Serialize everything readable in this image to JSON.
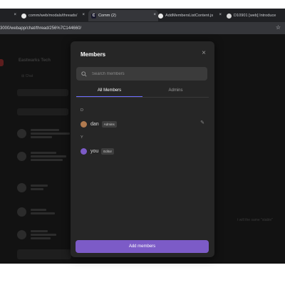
{
  "browser": {
    "tabs": [
      {
        "label": "",
        "close": "×"
      },
      {
        "label": "comm/web/modals/threads/",
        "close": "×",
        "icon": "github-icon"
      },
      {
        "label": "Comm (2)",
        "close": "×",
        "icon": "comm-icon",
        "icon_text": "C",
        "active": true
      },
      {
        "label": "AddMembersListContent.js",
        "close": "×",
        "icon": "github-icon"
      },
      {
        "label": "D10901 [web] Introduce",
        "close": "",
        "icon": "phabricator-icon"
      }
    ],
    "url": "3000/webapp/chat/thread/256%7C144660/",
    "star": "☆"
  },
  "background": {
    "title": "Eastwarks Tech",
    "tab": "⊞ Chat",
    "right_text": "t will the same \"stable\""
  },
  "modal": {
    "title": "Members",
    "close": "×",
    "search_placeholder": "Search members",
    "tabs": [
      "All Members",
      "Admins"
    ],
    "sections": [
      {
        "letter": "D",
        "members": [
          {
            "name": "dan",
            "role": "Admins",
            "avatar_color": "#b07a4f",
            "editable": true,
            "edit_icon": "✎"
          }
        ]
      },
      {
        "letter": "Y",
        "members": [
          {
            "name": "you",
            "role": "Editor",
            "avatar_color": "#7c5bc7",
            "editable": false
          }
        ]
      }
    ],
    "add_button": "Add members"
  },
  "colors": {
    "accent": "#7c5bc7",
    "modal_bg": "#262626",
    "app_bg": "#121212"
  }
}
